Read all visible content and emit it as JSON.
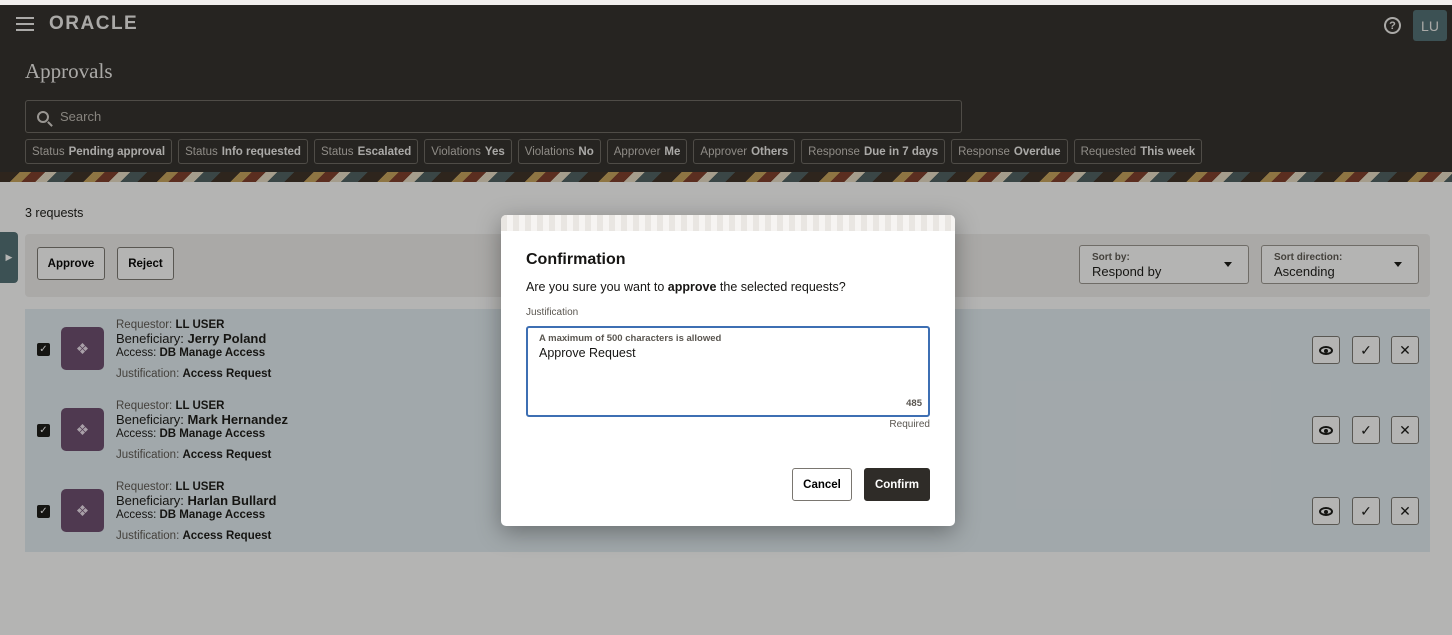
{
  "header": {
    "logo": "ORACLE",
    "title": "Approvals",
    "help_icon": "?",
    "avatar": "LU",
    "search_placeholder": "Search"
  },
  "filters": [
    {
      "key": "Status",
      "value": "Pending approval"
    },
    {
      "key": "Status",
      "value": "Info requested"
    },
    {
      "key": "Status",
      "value": "Escalated"
    },
    {
      "key": "Violations",
      "value": "Yes"
    },
    {
      "key": "Violations",
      "value": "No"
    },
    {
      "key": "Approver",
      "value": "Me"
    },
    {
      "key": "Approver",
      "value": "Others"
    },
    {
      "key": "Response",
      "value": "Due in 7 days"
    },
    {
      "key": "Response",
      "value": "Overdue"
    },
    {
      "key": "Requested",
      "value": "This week"
    }
  ],
  "list": {
    "count": "3 requests",
    "approve_label": "Approve",
    "reject_label": "Reject",
    "sort_by": {
      "label": "Sort by:",
      "value": "Respond by"
    },
    "sort_direction": {
      "label": "Sort direction:",
      "value": "Ascending"
    },
    "rows": [
      {
        "requestor_label": "Requestor:",
        "requestor": "LL USER",
        "beneficiary_label": "Beneficiary:",
        "beneficiary": "Jerry Poland",
        "access_label": "Access:",
        "access": "DB Manage Access",
        "justification_label": "Justification:",
        "justification": "Access Request",
        "checked": true
      },
      {
        "requestor_label": "Requestor:",
        "requestor": "LL USER",
        "beneficiary_label": "Beneficiary:",
        "beneficiary": "Mark Hernandez",
        "access_label": "Access:",
        "access": "DB Manage Access",
        "justification_label": "Justification:",
        "justification": "Access Request",
        "checked": true
      },
      {
        "requestor_label": "Requestor:",
        "requestor": "LL USER",
        "beneficiary_label": "Beneficiary:",
        "beneficiary": "Harlan Bullard",
        "access_label": "Access:",
        "access": "DB Manage Access",
        "justification_label": "Justification:",
        "justification": "Access Request",
        "checked": true
      }
    ]
  },
  "dialog": {
    "title": "Confirmation",
    "message_before": "Are you sure you want to",
    "message_bold": "approve",
    "message_after": "the selected requests?",
    "justification_label": "Justification",
    "hint": "A maximum of 500 characters is allowed",
    "value": "Approve Request",
    "remaining": "485",
    "required": "Required",
    "cancel_label": "Cancel",
    "confirm_label": "Confirm"
  },
  "colors": {
    "header_bg": "#2f2c28",
    "list_bg": "#e4edf3",
    "focus": "#3e6fb3",
    "primary_button": "#2f2c28"
  }
}
